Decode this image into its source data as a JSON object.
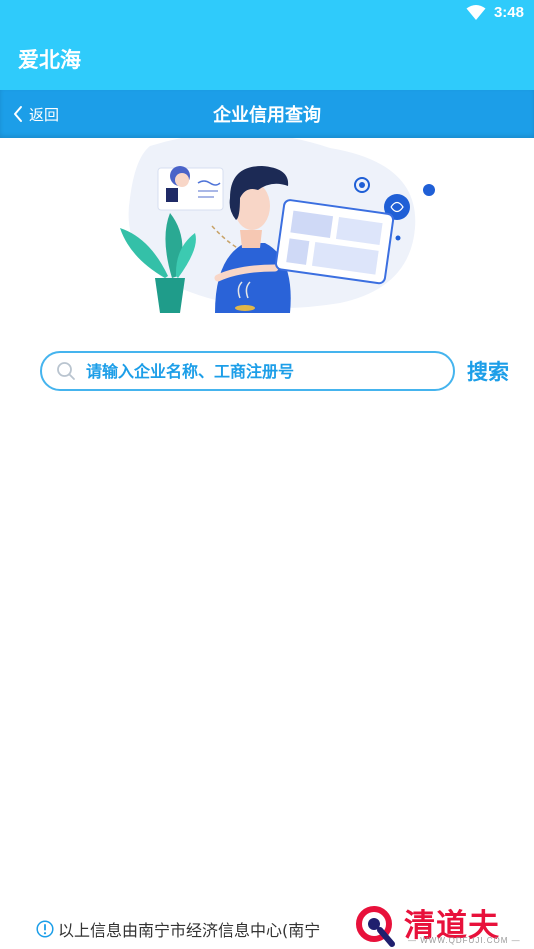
{
  "status_bar": {
    "time": "3:48",
    "wifi_icon": "wifi-icon"
  },
  "app": {
    "title": "爱北海"
  },
  "nav": {
    "back_label": "返回",
    "title": "企业信用查询"
  },
  "search": {
    "placeholder": "请输入企业名称、工商注册号",
    "value": "",
    "button_label": "搜索"
  },
  "footer": {
    "notice": "以上信息由南宁市经济信息中心(南宁"
  },
  "watermark": {
    "brand": "清道夫",
    "url": "— WWW.QDFUJI.COM —"
  },
  "colors": {
    "status_bar": "#2fcbfb",
    "nav_bar": "#1c9ee8",
    "accent": "#1c9ee8",
    "search_border": "#45b4ee",
    "watermark": "#e8113b"
  }
}
